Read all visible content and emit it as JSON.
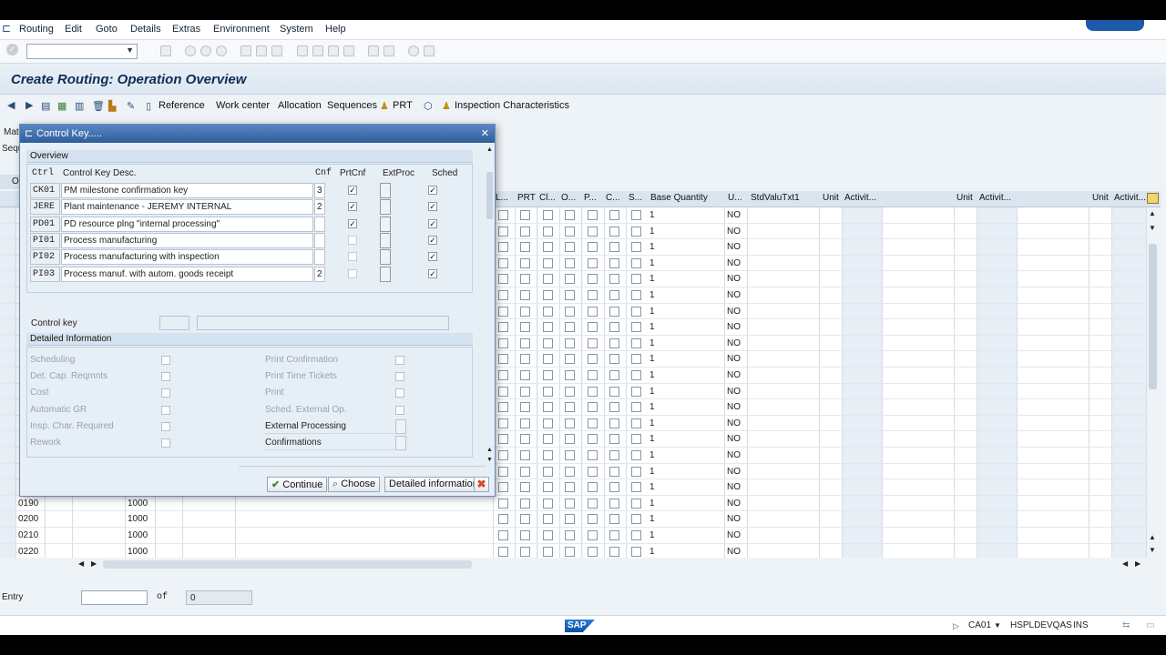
{
  "menu": [
    "Routing",
    "Edit",
    "Goto",
    "Details",
    "Extras",
    "Environment",
    "System",
    "Help"
  ],
  "title": "Create Routing: Operation Overview",
  "app_toolbar": {
    "reference": "Reference",
    "work_center": "Work center",
    "allocation": "Allocation",
    "sequences": "Sequences",
    "prt": "PRT",
    "inspection": "Inspection Characteristics"
  },
  "left_labels": {
    "mat": "Mat",
    "seq": "Sequ",
    "o": "O"
  },
  "grid": {
    "headers": [
      "L...",
      "PRT",
      "Cl...",
      "O...",
      "P...",
      "C...",
      "S...",
      "Base Quantity",
      "U...",
      "StdValuTxt1",
      "Unit",
      "Activit...",
      "Unit",
      "Activit...",
      "Unit",
      "Activit..."
    ],
    "base_qty": "1",
    "unit": "NO",
    "visible_ops": [
      {
        "op": "0190",
        "wc": "1000"
      },
      {
        "op": "0200",
        "wc": "1000"
      },
      {
        "op": "0210",
        "wc": "1000"
      },
      {
        "op": "0220",
        "wc": "1000"
      }
    ]
  },
  "dialog": {
    "title": "Control Key.....",
    "overview_label": "Overview",
    "col_ctrl": "Ctrl",
    "col_desc": "Control Key Desc.",
    "col_cnf": "Cnf",
    "col_prtcnf": "PrtCnf",
    "col_extproc": "ExtProc",
    "col_sched": "Sched",
    "keys": [
      {
        "code": "CK01",
        "desc": "PM milestone confirmation key",
        "cnf": "3",
        "prtcnf": true,
        "extproc": false,
        "sched": true
      },
      {
        "code": "JERE",
        "desc": "Plant maintenance - JEREMY INTERNAL",
        "cnf": "2",
        "prtcnf": true,
        "extproc": false,
        "sched": true
      },
      {
        "code": "PD01",
        "desc": "PD resource plng \"internal processing\"",
        "cnf": "",
        "prtcnf": true,
        "extproc": false,
        "sched": true
      },
      {
        "code": "PI01",
        "desc": "Process manufacturing",
        "cnf": "",
        "prtcnf": false,
        "extproc": false,
        "sched": true
      },
      {
        "code": "PI02",
        "desc": "Process manufacturing with inspection",
        "cnf": "",
        "prtcnf": false,
        "extproc": false,
        "sched": true
      },
      {
        "code": "PI03",
        "desc": "Process manuf. with autom. goods receipt",
        "cnf": "2",
        "prtcnf": false,
        "extproc": false,
        "sched": true
      }
    ],
    "control_key_label": "Control key",
    "detailed_label": "Detailed Information",
    "left_fields": [
      "Scheduling",
      "Det. Cap. Reqmnts",
      "Cost",
      "Automatic GR",
      "Insp. Char. Required",
      "Rework"
    ],
    "right_fields": [
      "Print Confirmation",
      "Print Time Tickets",
      "Print",
      "Sched. External Op.",
      "External Processing",
      "Confirmations"
    ],
    "buttons": {
      "continue": "Continue",
      "choose": "Choose",
      "detailed": "Detailed information"
    }
  },
  "footer": {
    "entry_label": "Entry",
    "of_label": "of",
    "count": "0"
  },
  "status": {
    "tcode": "CA01",
    "system": "HSPLDEVQAS",
    "mode": "INS",
    "sap_logo": "SAP"
  },
  "colors": {
    "title_blue": "#0c2d55",
    "dialog_header": "#3b6aab",
    "accent_green": "#5a9e2f",
    "cancel_red": "#d94a2c"
  }
}
